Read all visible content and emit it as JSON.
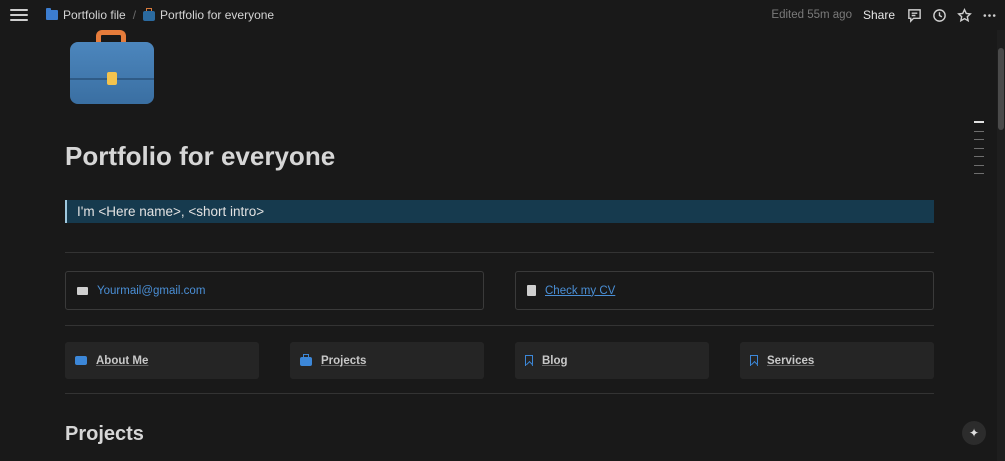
{
  "topbar": {
    "breadcrumb": [
      {
        "label": "Portfolio file",
        "icon": "folder-icon"
      },
      {
        "label": "Portfolio for everyone",
        "icon": "briefcase-icon"
      }
    ],
    "separator": "/",
    "edited": "Edited 55m ago",
    "share_label": "Share",
    "icons": [
      "comments-icon",
      "history-icon",
      "star-icon",
      "more-icon"
    ]
  },
  "page": {
    "icon": "briefcase-icon",
    "title": "Portfolio for everyone",
    "callout_text": "I'm <Here name>, <short intro>"
  },
  "contacts": [
    {
      "icon": "email-icon",
      "label": "Yourmail@gmail.com"
    },
    {
      "icon": "document-icon",
      "label": "Check my CV"
    }
  ],
  "nav_cards": [
    {
      "icon": "id-card-icon",
      "label": "About Me"
    },
    {
      "icon": "briefcase-icon",
      "label": "Projects"
    },
    {
      "icon": "bookmark-icon",
      "label": "Blog"
    },
    {
      "icon": "bookmark-icon",
      "label": "Services"
    }
  ],
  "section_heading": "Projects",
  "colors": {
    "background": "#191919",
    "callout": "#163a4e",
    "link": "#4a8fd6",
    "accent_icon": "#3c87d8"
  }
}
